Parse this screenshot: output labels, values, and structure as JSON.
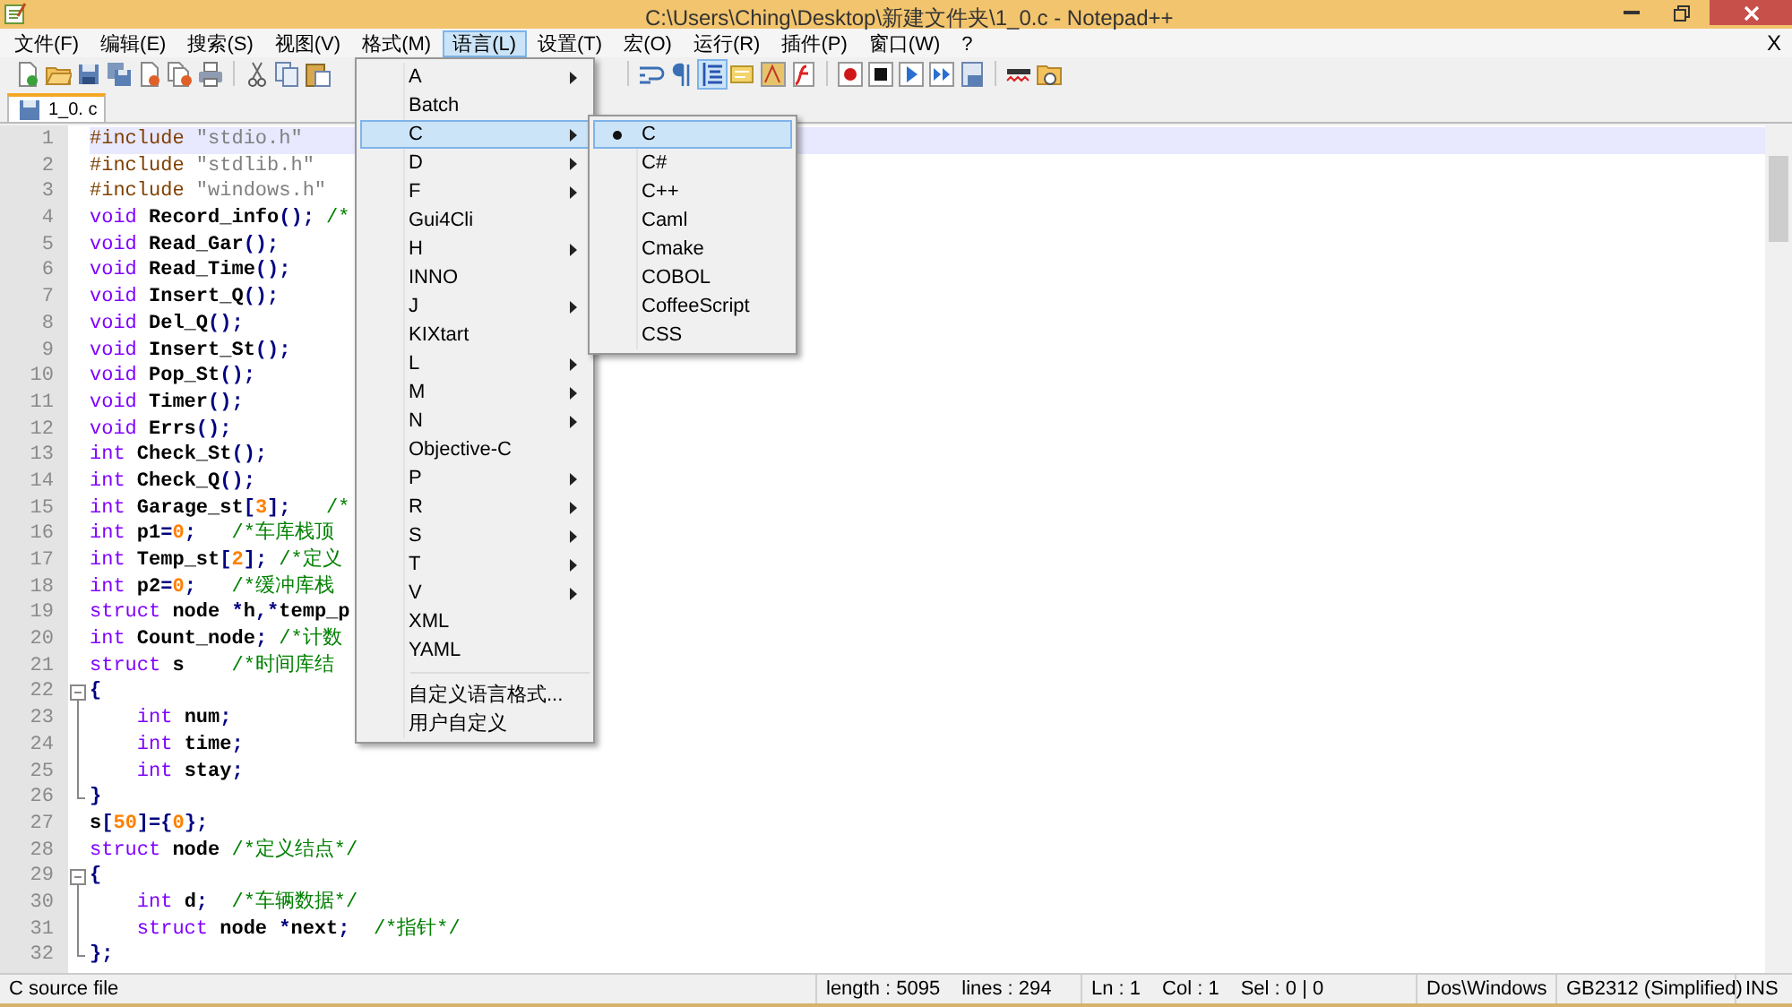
{
  "window": {
    "title": "C:\\Users\\Ching\\Desktop\\新建文件夹\\1_0.c - Notepad++"
  },
  "menu_bar": [
    {
      "label": "文件(F)",
      "selected": false
    },
    {
      "label": "编辑(E)",
      "selected": false
    },
    {
      "label": "搜索(S)",
      "selected": false
    },
    {
      "label": "视图(V)",
      "selected": false
    },
    {
      "label": "格式(M)",
      "selected": false
    },
    {
      "label": "语言(L)",
      "selected": true
    },
    {
      "label": "设置(T)",
      "selected": false
    },
    {
      "label": "宏(O)",
      "selected": false
    },
    {
      "label": "运行(R)",
      "selected": false
    },
    {
      "label": "插件(P)",
      "selected": false
    },
    {
      "label": "窗口(W)",
      "selected": false
    },
    {
      "label": "?",
      "selected": false
    }
  ],
  "close_document": "X",
  "tabs": [
    {
      "label": "1_0. c",
      "selected": true
    }
  ],
  "editor": {
    "lines": [
      {
        "number": "1",
        "current": true,
        "kind": "plain",
        "tokens": [
          {
            "kind": "pre",
            "text": "#include"
          },
          {
            "kind": "str",
            "text": " \"stdio.h\""
          }
        ]
      },
      {
        "number": "2",
        "current": false,
        "kind": "plain",
        "tokens": [
          {
            "kind": "pre",
            "text": "#include"
          },
          {
            "kind": "str",
            "text": " \"stdlib.h\""
          }
        ]
      },
      {
        "number": "3",
        "current": false,
        "kind": "plain",
        "tokens": [
          {
            "kind": "pre",
            "text": "#include"
          },
          {
            "kind": "str",
            "text": " \"windows.h\""
          }
        ]
      },
      {
        "number": "4",
        "current": false,
        "kind": "plain",
        "tokens": [
          {
            "kind": "kw",
            "text": "void"
          },
          {
            "kind": "plain",
            "text": " Record_info"
          },
          {
            "kind": "op",
            "text": "();"
          },
          {
            "kind": "cm",
            "text": " /*"
          }
        ]
      },
      {
        "number": "5",
        "current": false,
        "kind": "plain",
        "tokens": [
          {
            "kind": "kw",
            "text": "void"
          },
          {
            "kind": "plain",
            "text": " Read_Gar"
          },
          {
            "kind": "op",
            "text": "();"
          }
        ]
      },
      {
        "number": "6",
        "current": false,
        "kind": "plain",
        "tokens": [
          {
            "kind": "kw",
            "text": "void"
          },
          {
            "kind": "plain",
            "text": " Read_Time"
          },
          {
            "kind": "op",
            "text": "();"
          }
        ]
      },
      {
        "number": "7",
        "current": false,
        "kind": "plain",
        "tokens": [
          {
            "kind": "kw",
            "text": "void"
          },
          {
            "kind": "plain",
            "text": " Insert_Q"
          },
          {
            "kind": "op",
            "text": "();"
          }
        ]
      },
      {
        "number": "8",
        "current": false,
        "kind": "plain",
        "tokens": [
          {
            "kind": "kw",
            "text": "void"
          },
          {
            "kind": "plain",
            "text": " Del_Q"
          },
          {
            "kind": "op",
            "text": "();"
          }
        ]
      },
      {
        "number": "9",
        "current": false,
        "kind": "plain",
        "tokens": [
          {
            "kind": "kw",
            "text": "void"
          },
          {
            "kind": "plain",
            "text": " Insert_St"
          },
          {
            "kind": "op",
            "text": "();"
          }
        ]
      },
      {
        "number": "10",
        "current": false,
        "kind": "plain",
        "tokens": [
          {
            "kind": "kw",
            "text": "void"
          },
          {
            "kind": "plain",
            "text": " Pop_St"
          },
          {
            "kind": "op",
            "text": "();"
          }
        ]
      },
      {
        "number": "11",
        "current": false,
        "kind": "plain",
        "tokens": [
          {
            "kind": "kw",
            "text": "void"
          },
          {
            "kind": "plain",
            "text": " Timer"
          },
          {
            "kind": "op",
            "text": "();"
          }
        ]
      },
      {
        "number": "12",
        "current": false,
        "kind": "plain",
        "tokens": [
          {
            "kind": "kw",
            "text": "void"
          },
          {
            "kind": "plain",
            "text": " Errs"
          },
          {
            "kind": "op",
            "text": "();"
          }
        ]
      },
      {
        "number": "13",
        "current": false,
        "kind": "plain",
        "tokens": [
          {
            "kind": "kw",
            "text": "int"
          },
          {
            "kind": "plain",
            "text": " Check_St"
          },
          {
            "kind": "op",
            "text": "();"
          }
        ]
      },
      {
        "number": "14",
        "current": false,
        "kind": "plain",
        "tokens": [
          {
            "kind": "kw",
            "text": "int"
          },
          {
            "kind": "plain",
            "text": " Check_Q"
          },
          {
            "kind": "op",
            "text": "();"
          }
        ]
      },
      {
        "number": "15",
        "current": false,
        "kind": "plain",
        "tokens": [
          {
            "kind": "kw",
            "text": "int"
          },
          {
            "kind": "plain",
            "text": " Garage_st"
          },
          {
            "kind": "op",
            "text": "["
          },
          {
            "kind": "num",
            "text": "3"
          },
          {
            "kind": "op",
            "text": "];"
          },
          {
            "kind": "cm",
            "text": "   /*"
          }
        ]
      },
      {
        "number": "16",
        "current": false,
        "kind": "plain",
        "tokens": [
          {
            "kind": "kw",
            "text": "int"
          },
          {
            "kind": "plain",
            "text": " p1"
          },
          {
            "kind": "op",
            "text": "="
          },
          {
            "kind": "num",
            "text": "0"
          },
          {
            "kind": "op",
            "text": ";"
          },
          {
            "kind": "cm",
            "text": "   /*车库栈顶"
          }
        ]
      },
      {
        "number": "17",
        "current": false,
        "kind": "plain",
        "tokens": [
          {
            "kind": "kw",
            "text": "int"
          },
          {
            "kind": "plain",
            "text": " Temp_st"
          },
          {
            "kind": "op",
            "text": "["
          },
          {
            "kind": "num",
            "text": "2"
          },
          {
            "kind": "op",
            "text": "];"
          },
          {
            "kind": "cm",
            "text": " /*定义"
          }
        ]
      },
      {
        "number": "18",
        "current": false,
        "kind": "plain",
        "tokens": [
          {
            "kind": "kw",
            "text": "int"
          },
          {
            "kind": "plain",
            "text": " p2"
          },
          {
            "kind": "op",
            "text": "="
          },
          {
            "kind": "num",
            "text": "0"
          },
          {
            "kind": "op",
            "text": ";"
          },
          {
            "kind": "cm",
            "text": "   /*缓冲库栈"
          }
        ]
      },
      {
        "number": "19",
        "current": false,
        "kind": "plain",
        "tokens": [
          {
            "kind": "kw",
            "text": "struct"
          },
          {
            "kind": "plain",
            "text": " node "
          },
          {
            "kind": "op",
            "text": "*"
          },
          {
            "kind": "plain",
            "text": "h"
          },
          {
            "kind": "op",
            "text": ",*"
          },
          {
            "kind": "plain",
            "text": "temp_p"
          }
        ]
      },
      {
        "number": "20",
        "current": false,
        "kind": "plain",
        "tokens": [
          {
            "kind": "kw",
            "text": "int"
          },
          {
            "kind": "plain",
            "text": " Count_node"
          },
          {
            "kind": "op",
            "text": ";"
          },
          {
            "kind": "cm",
            "text": " /*计数"
          }
        ]
      },
      {
        "number": "21",
        "current": false,
        "kind": "plain",
        "tokens": [
          {
            "kind": "kw",
            "text": "struct"
          },
          {
            "kind": "plain",
            "text": " s"
          },
          {
            "kind": "cm",
            "text": "    /*时间库结"
          }
        ]
      },
      {
        "number": "22",
        "current": false,
        "kind": "fold_start",
        "tokens": [
          {
            "kind": "op",
            "text": "{"
          }
        ]
      },
      {
        "number": "23",
        "current": false,
        "kind": "fold_body",
        "tokens": [
          {
            "kind": "kw",
            "text": "    int"
          },
          {
            "kind": "plain",
            "text": " num"
          },
          {
            "kind": "op",
            "text": ";"
          }
        ]
      },
      {
        "number": "24",
        "current": false,
        "kind": "fold_body",
        "tokens": [
          {
            "kind": "kw",
            "text": "    int"
          },
          {
            "kind": "plain",
            "text": " time"
          },
          {
            "kind": "op",
            "text": ";"
          }
        ]
      },
      {
        "number": "25",
        "current": false,
        "kind": "fold_body",
        "tokens": [
          {
            "kind": "kw",
            "text": "    int"
          },
          {
            "kind": "plain",
            "text": " stay"
          },
          {
            "kind": "op",
            "text": ";"
          }
        ]
      },
      {
        "number": "26",
        "current": false,
        "kind": "fold_end",
        "tokens": [
          {
            "kind": "op",
            "text": "}"
          }
        ]
      },
      {
        "number": "27",
        "current": false,
        "kind": "plain",
        "tokens": [
          {
            "kind": "plain",
            "text": "s"
          },
          {
            "kind": "op",
            "text": "["
          },
          {
            "kind": "num",
            "text": "50"
          },
          {
            "kind": "op",
            "text": "]={"
          },
          {
            "kind": "num",
            "text": "0"
          },
          {
            "kind": "op",
            "text": "};"
          }
        ]
      },
      {
        "number": "28",
        "current": false,
        "kind": "plain",
        "tokens": [
          {
            "kind": "kw",
            "text": "struct"
          },
          {
            "kind": "plain",
            "text": " node"
          },
          {
            "kind": "cm",
            "text": " /*定义结点*/"
          }
        ]
      },
      {
        "number": "29",
        "current": false,
        "kind": "fold_start",
        "tokens": [
          {
            "kind": "op",
            "text": "{"
          }
        ]
      },
      {
        "number": "30",
        "current": false,
        "kind": "fold_body",
        "tokens": [
          {
            "kind": "kw",
            "text": "    int"
          },
          {
            "kind": "plain",
            "text": " d"
          },
          {
            "kind": "op",
            "text": ";"
          },
          {
            "kind": "cm",
            "text": "  /*车辆数据*/"
          }
        ]
      },
      {
        "number": "31",
        "current": false,
        "kind": "fold_body",
        "tokens": [
          {
            "kind": "kw",
            "text": "    struct"
          },
          {
            "kind": "plain",
            "text": " node "
          },
          {
            "kind": "op",
            "text": "*"
          },
          {
            "kind": "plain",
            "text": "next"
          },
          {
            "kind": "op",
            "text": ";"
          },
          {
            "kind": "cm",
            "text": "  /*指针*/"
          }
        ]
      },
      {
        "number": "32",
        "current": false,
        "kind": "fold_end",
        "tokens": [
          {
            "kind": "op",
            "text": "};"
          }
        ]
      }
    ]
  },
  "language_menu": {
    "items": [
      {
        "label": "A",
        "submenu": true,
        "selected": false
      },
      {
        "label": "Batch",
        "submenu": false,
        "selected": false
      },
      {
        "label": "C",
        "submenu": true,
        "selected": true
      },
      {
        "label": "D",
        "submenu": true,
        "selected": false
      },
      {
        "label": "F",
        "submenu": true,
        "selected": false
      },
      {
        "label": "Gui4Cli",
        "submenu": false,
        "selected": false
      },
      {
        "label": "H",
        "submenu": true,
        "selected": false
      },
      {
        "label": "INNO",
        "submenu": false,
        "selected": false
      },
      {
        "label": "J",
        "submenu": true,
        "selected": false
      },
      {
        "label": "KIXtart",
        "submenu": false,
        "selected": false
      },
      {
        "label": "L",
        "submenu": true,
        "selected": false
      },
      {
        "label": "M",
        "submenu": true,
        "selected": false
      },
      {
        "label": "N",
        "submenu": true,
        "selected": false
      },
      {
        "label": "Objective-C",
        "submenu": false,
        "selected": false
      },
      {
        "label": "P",
        "submenu": true,
        "selected": false
      },
      {
        "label": "R",
        "submenu": true,
        "selected": false
      },
      {
        "label": "S",
        "submenu": true,
        "selected": false
      },
      {
        "label": "T",
        "submenu": true,
        "selected": false
      },
      {
        "label": "V",
        "submenu": true,
        "selected": false
      },
      {
        "label": "XML",
        "submenu": false,
        "selected": false
      },
      {
        "label": "YAML",
        "submenu": false,
        "selected": false
      }
    ],
    "extra_items": [
      {
        "label": "自定义语言格式...",
        "selected": false
      },
      {
        "label": "用户自定义",
        "selected": false
      }
    ]
  },
  "c_submenu": {
    "items": [
      {
        "label": "C",
        "checked": true,
        "selected": true
      },
      {
        "label": "C#",
        "checked": false,
        "selected": false
      },
      {
        "label": "C++",
        "checked": false,
        "selected": false
      },
      {
        "label": "Caml",
        "checked": false,
        "selected": false
      },
      {
        "label": "Cmake",
        "checked": false,
        "selected": false
      },
      {
        "label": "COBOL",
        "checked": false,
        "selected": false
      },
      {
        "label": "CoffeeScript",
        "checked": false,
        "selected": false
      },
      {
        "label": "CSS",
        "checked": false,
        "selected": false
      }
    ]
  },
  "status_bar": {
    "file_type": "C source file",
    "length": "length : 5095",
    "lines": "lines : 294",
    "ln": "Ln : 1",
    "col": "Col : 1",
    "sel": "Sel : 0 | 0",
    "eol": "Dos\\Windows",
    "encoding": "GB2312 (Simplified)",
    "mode": "INS"
  }
}
